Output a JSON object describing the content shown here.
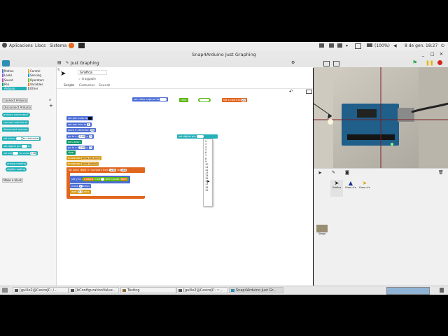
{
  "top_panel": {
    "apps": "Aplicacions",
    "places": "Llocs",
    "system": "Sistema",
    "battery": "(100%)",
    "date": "8 de gen.",
    "time": "18:27"
  },
  "window": {
    "title": "Snap4Arduino Just Graphing"
  },
  "project": {
    "name": "Just Graphing"
  },
  "sprite": {
    "name": "Gràfica",
    "draggable_label": "draggable",
    "tabs": [
      "Scripts",
      "Costumes",
      "Sounds"
    ]
  },
  "categories": [
    {
      "label": "Motion",
      "color": "#4a6cd4"
    },
    {
      "label": "Looks",
      "color": "#8a55d7"
    },
    {
      "label": "Sound",
      "color": "#bb42c3"
    },
    {
      "label": "Pen",
      "color": "#0e9a6c"
    },
    {
      "label": "Arduino",
      "color": "#24b0b8"
    },
    {
      "label": "Control",
      "color": "#e6a822"
    },
    {
      "label": "Sensing",
      "color": "#0494dc"
    },
    {
      "label": "Operators",
      "color": "#62c213"
    },
    {
      "label": "Variables",
      "color": "#f3761d"
    },
    {
      "label": "Other",
      "color": "#969696"
    }
  ],
  "palette": {
    "connect": "Connect Arduino",
    "disconnect": "Disconnect Arduino",
    "blocks": [
      "arduino connected?",
      "connect arduino at",
      "disconnect arduino",
      "set servo",
      "to clockwise",
      "set digital pin",
      "to",
      "set pin",
      "to value",
      "128",
      "analog reading",
      "digital reading"
    ],
    "make_block": "Make a block"
  },
  "scripts": {
    "top": {
      "set_video": "set video capture",
      "to": "to",
      "clear": "clear",
      "set_xcoord": "set x coord",
      "to_value": "to",
      "xcoord_val": "20"
    },
    "main": {
      "set_pen_color": "set pen color to",
      "set_pen_size": "set pen size to",
      "pen_size_val": "1",
      "point_dir": "point in direction",
      "dir_val": "90",
      "go_to_1": "go to x:",
      "x1": "-240",
      "y_label1": "y:",
      "y1": "0",
      "pen_down": "pen down",
      "go_to_2": "go to x:",
      "x2": "-240",
      "y_label2": "y:",
      "y2": "0",
      "clear": "clear",
      "broadcast1": "broadcast",
      "broadcast1_msg": "pinta del punt",
      "broadcast2": "broadcast",
      "broadcast2_msg": "pinta costat",
      "for_each": "for each",
      "item": "item",
      "in_numbers": "in numbers from",
      "from": "-240",
      "to_word": "to",
      "to_num": "240",
      "set_y": "set y to",
      "x_coord": "x coord",
      "mod": "mod",
      "with_inputs": "with inputs",
      "item2": "item",
      "move": "move",
      "move_val": "1",
      "steps": "steps",
      "wait": "wait",
      "wait_val": "0.1",
      "secs": "secs"
    },
    "floating": {
      "set_digital": "set digital pin",
      "pins": [
        "2",
        "3",
        "4",
        "5",
        "6",
        "7",
        "8",
        "9",
        "10",
        "11",
        "12",
        "13",
        "14",
        "15",
        "16",
        "17",
        "18",
        "19"
      ]
    }
  },
  "corral": {
    "sprites": [
      "Gràfica",
      "Eixos d'x",
      "Eixos d'x"
    ],
    "stage": "Stage"
  },
  "taskbar": {
    "items": [
      "[guille2@CesireJC: /...",
      "[bConfigurationValue...",
      "Testing",
      "[guille2@CesireJC: ~...",
      "Snap4Arduino Just Gr..."
    ]
  },
  "colors": {
    "motion": "#4a6cd4",
    "operators": "#5cb712",
    "control": "#d99c1b",
    "variables": "#e1661e",
    "green_flag": "#2aa84a",
    "stop": "#d6261d"
  }
}
